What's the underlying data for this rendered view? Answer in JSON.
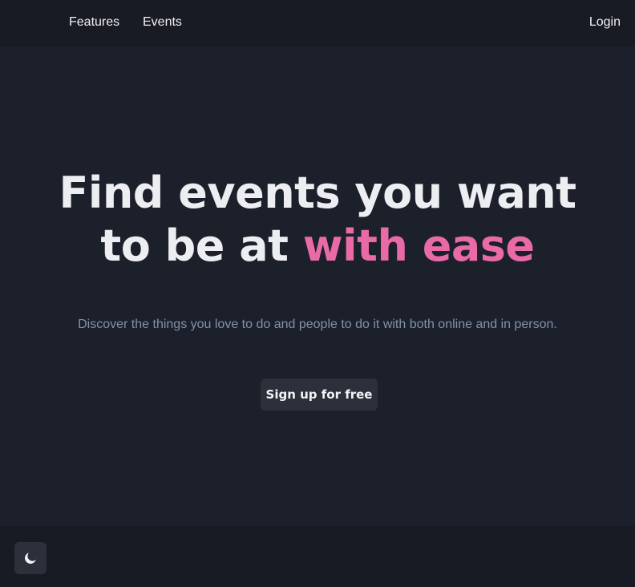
{
  "nav": {
    "features_label": "Features",
    "events_label": "Events",
    "login_label": "Login"
  },
  "hero": {
    "headline_line1": "Find events you want",
    "headline_line2_prefix": "to be at ",
    "headline_line2_accent": "with ease",
    "subtitle": "Discover the things you love to do and people to do it with both online and in person.",
    "cta_label": "Sign up for free"
  },
  "footer": {
    "theme_toggle_icon": "moon-icon"
  },
  "colors": {
    "background": "#1c202b",
    "navbar": "#181b23",
    "accent": "#e86aa6",
    "button": "#2c303b",
    "subtitle": "#8192ab"
  }
}
